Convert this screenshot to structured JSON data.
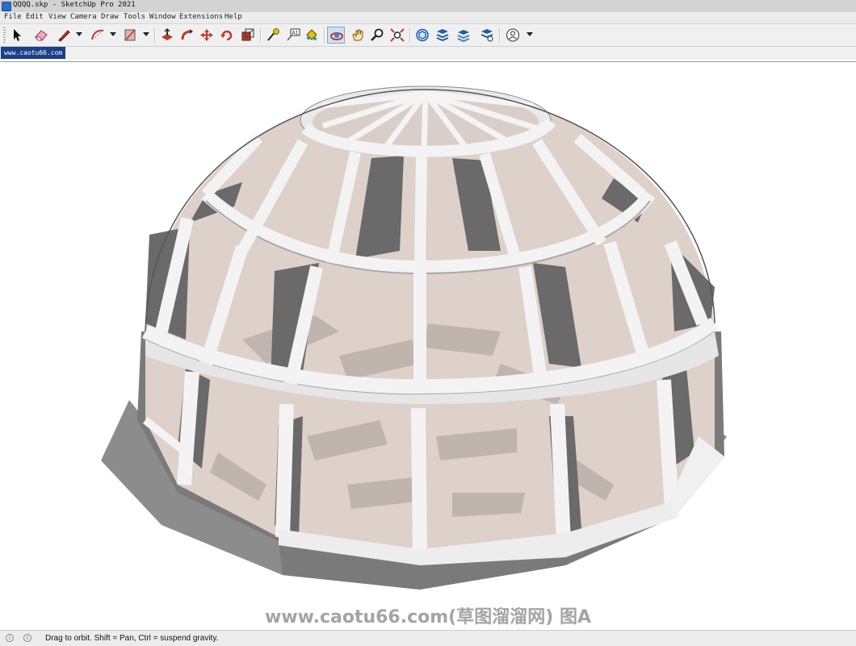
{
  "window": {
    "title": "QQQQ.skp - SketchUp Pro 2021"
  },
  "menu": {
    "items": [
      "File",
      "Edit",
      "View",
      "Camera",
      "Draw",
      "Tools",
      "Window",
      "Extensions",
      "Help"
    ]
  },
  "toolbar": {
    "tools": [
      {
        "icon": "select-arrow-icon"
      },
      {
        "icon": "eraser-icon"
      },
      {
        "icon": "pencil-line-icon",
        "dropdown": true
      },
      {
        "icon": "arc-icon",
        "dropdown": true
      },
      {
        "icon": "rectangle-icon",
        "dropdown": true
      },
      {
        "icon": "push-pull-icon"
      },
      {
        "icon": "follow-me-icon"
      },
      {
        "icon": "move-icon"
      },
      {
        "icon": "rotate-icon"
      },
      {
        "icon": "scale-icon"
      },
      {
        "icon": "tape-measure-icon"
      },
      {
        "icon": "text-label-icon"
      },
      {
        "icon": "paint-bucket-icon"
      },
      {
        "icon": "orbit-icon",
        "active": true
      },
      {
        "icon": "pan-hand-icon"
      },
      {
        "icon": "zoom-icon"
      },
      {
        "icon": "zoom-extents-icon"
      },
      {
        "icon": "3d-warehouse-icon"
      },
      {
        "icon": "extension-warehouse-icon"
      },
      {
        "icon": "layout-icon"
      },
      {
        "icon": "extension-manager-icon"
      },
      {
        "icon": "account-icon",
        "dropdown": true
      }
    ]
  },
  "tab": {
    "label": "www.caotu66.com"
  },
  "watermark": "www.caotu66.com(草图溜溜网) 图A",
  "status": {
    "text": "Drag to orbit. Shift = Pan, Ctrl = suspend gravity.",
    "icon_1": "i",
    "icon_2": "i"
  },
  "colors": {
    "tab_bg": "#1c3f8a",
    "frame_light": "#f2f2f2",
    "frame_dark": "#6e6e6e",
    "glass": "#dcd0c8"
  }
}
